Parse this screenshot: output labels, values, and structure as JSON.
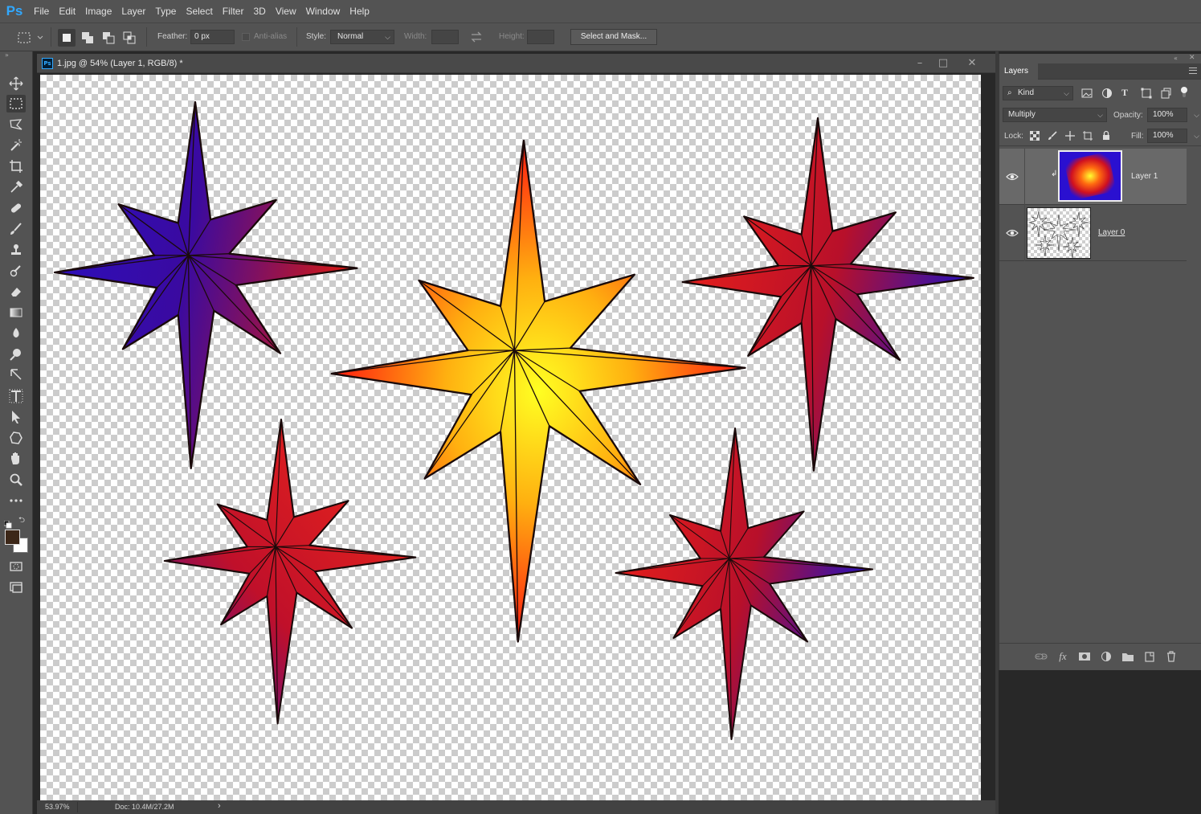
{
  "app": {
    "logo": "Ps",
    "accent": "#31a8ff"
  },
  "menu": [
    "File",
    "Edit",
    "Image",
    "Layer",
    "Type",
    "Select",
    "Filter",
    "3D",
    "View",
    "Window",
    "Help"
  ],
  "options": {
    "feather_label": "Feather:",
    "feather_value": "0 px",
    "antialias_label": "Anti-alias",
    "style_label": "Style:",
    "style_value": "Normal",
    "width_label": "Width:",
    "height_label": "Height:",
    "select_mask_label": "Select and Mask..."
  },
  "document": {
    "title": "1.jpg @ 54% (Layer 1, RGB/8) *",
    "zoom": "53.97%",
    "doc_size": "Doc: 10.4M/27.2M",
    "status_arrow": "›"
  },
  "layers_panel": {
    "tab_label": "Layers",
    "kind_label": "Kind",
    "blend_mode": "Multiply",
    "opacity_label": "Opacity:",
    "opacity_value": "100%",
    "lock_label": "Lock:",
    "fill_label": "Fill:",
    "fill_value": "100%",
    "layers": [
      {
        "name": "Layer 1",
        "visible": true,
        "selected": true,
        "clipped": true
      },
      {
        "name": "Layer 0",
        "visible": true,
        "selected": false,
        "clipped": false
      }
    ]
  },
  "colors": {
    "foreground": "#3c2718",
    "background": "#ffffff",
    "star_purple": "#2d10b8",
    "star_red": "#e02020",
    "star_yellow": "#ffee20",
    "star_orange": "#ff8a10"
  },
  "icons": [
    "move-icon",
    "marquee-icon",
    "lasso-icon",
    "magic-wand-icon",
    "crop-icon",
    "eyedropper-icon",
    "healing-icon",
    "brush-icon",
    "stamp-icon",
    "history-brush-icon",
    "eraser-icon",
    "gradient-icon",
    "blur-icon",
    "dodge-icon",
    "pen-icon",
    "type-icon",
    "path-select-icon",
    "shape-icon",
    "hand-icon",
    "zoom-icon",
    "more-tools-icon"
  ]
}
